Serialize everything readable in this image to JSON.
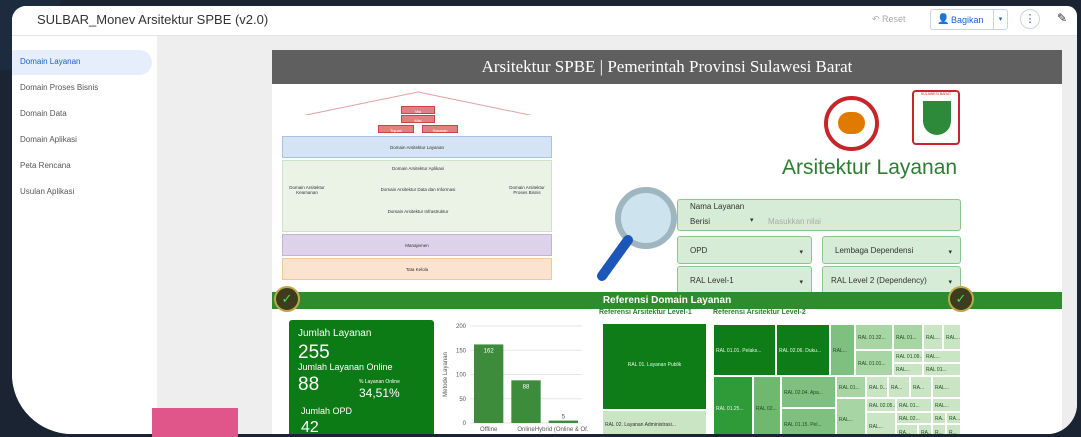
{
  "app": {
    "title": "SULBAR_Monev Arsitektur SPBE (v2.0)",
    "reset_label": "Reset",
    "share_label": "Bagikan"
  },
  "sidebar": {
    "items": [
      {
        "label": "Domain Layanan",
        "active": true
      },
      {
        "label": "Domain Proses Bisnis"
      },
      {
        "label": "Domain Data"
      },
      {
        "label": "Domain Aplikasi"
      },
      {
        "label": "Peta Rencana"
      },
      {
        "label": "Usulan Aplikasi"
      }
    ]
  },
  "report": {
    "header": "Arsitektur SPBE | Pemerintah Provinsi Sulawesi Barat",
    "page_title": "Arsitektur Layanan",
    "logo_text": "SULAWESI BARAT",
    "pyramid": {
      "visi": "Visi",
      "misi": "Misi",
      "tujuan": "Tujuan",
      "sasaran": "Sasaran",
      "layanan": "Domain Arsitektur Layanan",
      "aplikasi": "Domain Arsitektur Aplikasi",
      "data": "Domain Arsitektur Data dan Informasi",
      "infra": "Domain Arsitektur Infrastruktur",
      "keamanan": "Domain Arsitektur Keamanan",
      "proses": "Domain Arsitektur Proses Bisnis",
      "manajemen": "Manajemen",
      "tata_kelola": "Tata Kelola"
    },
    "filters": {
      "nama_layanan_label": "Nama Layanan",
      "nama_layanan_op": "Berisi",
      "nama_layanan_placeholder": "Masukkan nilai",
      "opd": "OPD",
      "lembaga": "Lembaga Dependensi",
      "ral1": "RAL Level-1",
      "ral2": "RAL Level 2 (Dependency)"
    },
    "section_title": "Referensi Domain Layanan",
    "kpi": {
      "jumlah_layanan_label": "Jumlah Layanan",
      "jumlah_layanan": "255",
      "online_label": "Jumlah Layanan Online",
      "online": "88",
      "pct_label": "% Layanan Online",
      "pct": "34,51%",
      "opd_label": "Jumlah OPD",
      "opd": "42"
    },
    "ref1_title": "Referensi Arsitektur Level-1",
    "ref2_title": "Referensi Arsitektur Level-2",
    "ref1_items": [
      "RAL 01. Layanan Publik",
      "RAL 02. Layanan Administrasi..."
    ],
    "ref2_items": [
      "RAL 01.01. Pelaks...",
      "RAL 02.06. Duku...",
      "RAL...",
      "RAL 01.32...",
      "RAL 01...",
      "RAL...",
      "RAL...",
      "RAL 01.01...",
      "RAL 01.09...",
      "RAL...",
      "RAL...",
      "RAL 01...",
      "RAL 01.25...",
      "RAL 02...",
      "RAL 02.04. Apa...",
      "RAL 01...",
      "RAL 0...",
      "RA...",
      "RA...",
      "RAL...",
      "RAL 02.05...",
      "RAL 01...",
      "RAL...",
      "RAL 02...",
      "RA...",
      "RA...",
      "RAL 01.15. Pel...",
      "RAL...",
      "RAL...",
      "RA...",
      "RA...",
      "R...",
      "R..."
    ]
  },
  "chart_data": {
    "type": "bar",
    "categories": [
      "Offline",
      "Online",
      "Hybrid (Online & Of..."
    ],
    "values": [
      162,
      88,
      5
    ],
    "xlabel": "",
    "ylabel": "Metode Layanan",
    "ylim": [
      0,
      200
    ],
    "yticks": [
      0,
      50,
      100,
      150,
      200
    ],
    "colors": {
      "bar": "#3c8c3c"
    }
  }
}
